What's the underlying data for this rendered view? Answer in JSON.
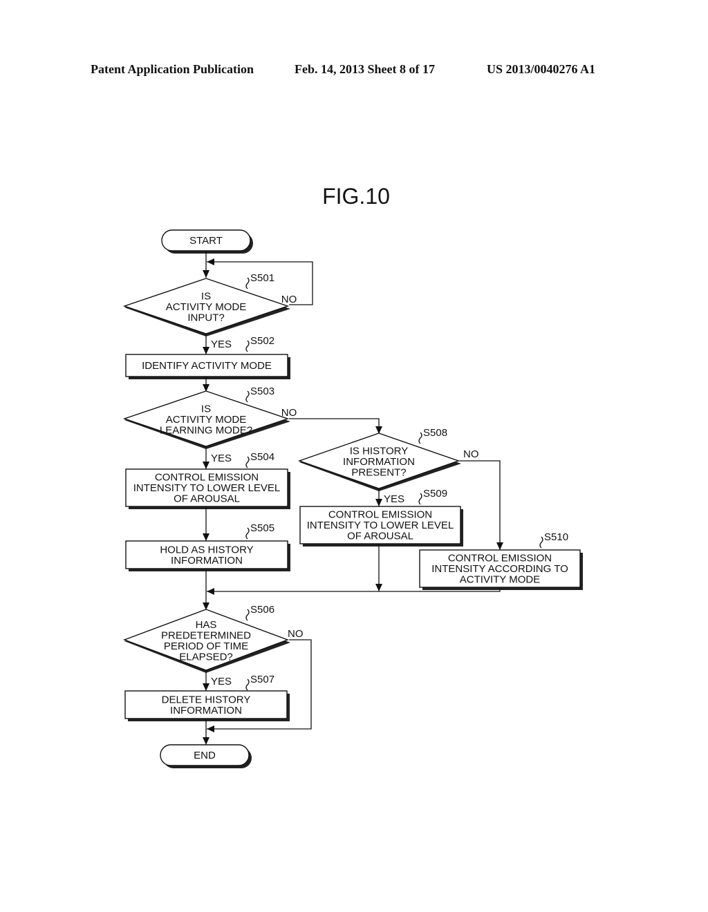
{
  "header": {
    "publication": "Patent Application Publication",
    "date_sheet": "Feb. 14, 2013   Sheet 8 of 17",
    "patent_number": "US 2013/0040276 A1"
  },
  "figure": {
    "title": "FIG.10",
    "terminals": {
      "start": "START",
      "end": "END"
    },
    "nodes": [
      {
        "id": "S501",
        "type": "decision",
        "lines": [
          "IS",
          "ACTIVITY MODE",
          "INPUT?"
        ]
      },
      {
        "id": "S502",
        "type": "process",
        "lines": [
          "IDENTIFY ACTIVITY MODE"
        ]
      },
      {
        "id": "S503",
        "type": "decision",
        "lines": [
          "IS",
          "ACTIVITY MODE",
          "LEARNING MODE?"
        ]
      },
      {
        "id": "S504",
        "type": "process",
        "lines": [
          "CONTROL EMISSION",
          "INTENSITY TO LOWER LEVEL",
          "OF AROUSAL"
        ]
      },
      {
        "id": "S505",
        "type": "process",
        "lines": [
          "HOLD AS HISTORY",
          "INFORMATION"
        ]
      },
      {
        "id": "S506",
        "type": "decision",
        "lines": [
          "HAS",
          "PREDETERMINED",
          "PERIOD OF TIME",
          "ELAPSED?"
        ]
      },
      {
        "id": "S507",
        "type": "process",
        "lines": [
          "DELETE HISTORY",
          "INFORMATION"
        ]
      },
      {
        "id": "S508",
        "type": "decision",
        "lines": [
          "IS HISTORY",
          "INFORMATION",
          "PRESENT?"
        ]
      },
      {
        "id": "S509",
        "type": "process",
        "lines": [
          "CONTROL EMISSION",
          "INTENSITY TO LOWER LEVEL",
          "OF AROUSAL"
        ]
      },
      {
        "id": "S510",
        "type": "process",
        "lines": [
          "CONTROL EMISSION",
          "INTENSITY ACCORDING TO",
          "ACTIVITY MODE"
        ]
      }
    ],
    "branch_labels": {
      "yes": "YES",
      "no": "NO"
    }
  }
}
